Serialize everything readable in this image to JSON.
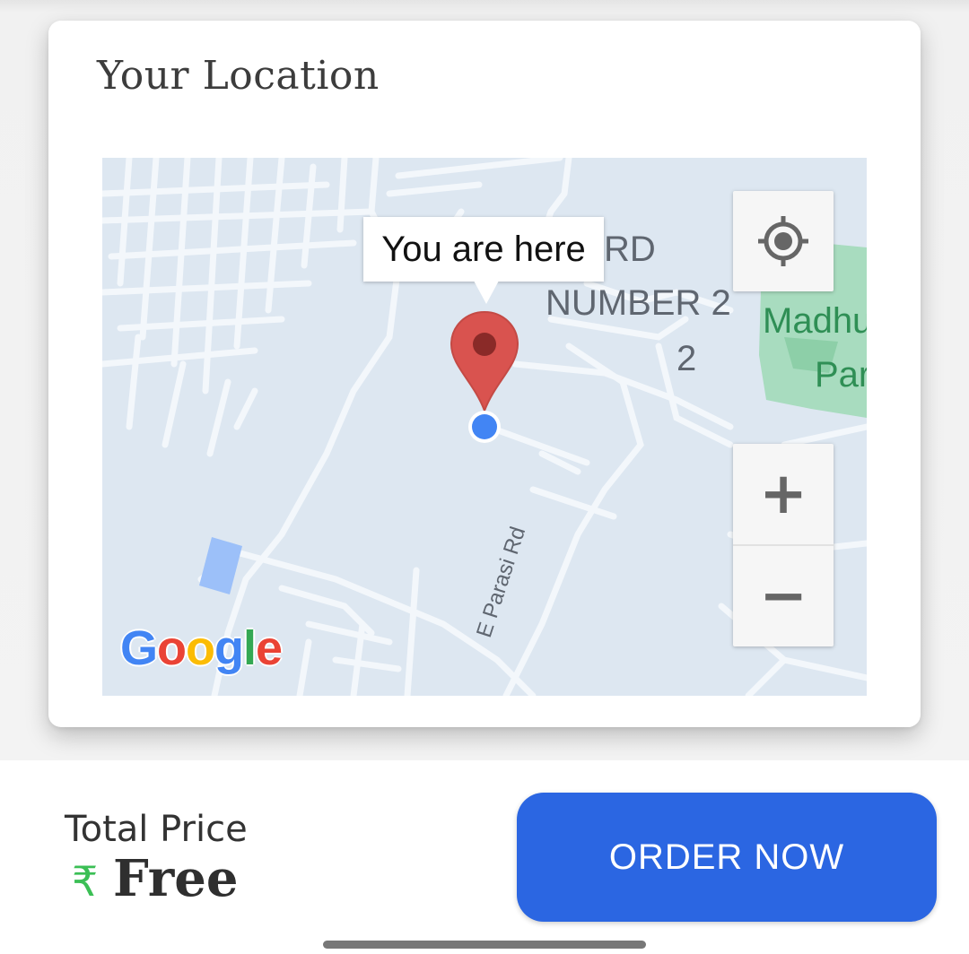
{
  "location_card": {
    "title": "Your Location"
  },
  "map": {
    "tooltip": "You are here",
    "labels": {
      "ward_line1": "WARD",
      "ward_line2": "NUMBER 2",
      "ward_line3": "2",
      "park_line1": "Madhu",
      "park_line2": "Par",
      "road": "E Parasi Rd"
    },
    "zoom_in_label": "+",
    "zoom_out_label": "−",
    "attribution": {
      "letters": [
        "G",
        "o",
        "o",
        "g",
        "l",
        "e"
      ],
      "colors": [
        "#4285F4",
        "#EA4335",
        "#FBBC05",
        "#4285F4",
        "#34A853",
        "#EA4335"
      ]
    },
    "colors": {
      "background": "#dde7f1",
      "roads": "#f3f7fb",
      "park": "#a8dcbf",
      "water": "#9cc0f9",
      "marker": "#d9534f",
      "my_location": "#4285f4"
    }
  },
  "footer": {
    "total_label": "Total Price",
    "currency_symbol": "₹",
    "price": "Free",
    "order_button_label": "ORDER NOW",
    "accent": "#2b66e2"
  },
  "icons": {
    "locate": "my-location-icon",
    "marker": "map-pin-icon",
    "currency": "rupee-icon"
  }
}
